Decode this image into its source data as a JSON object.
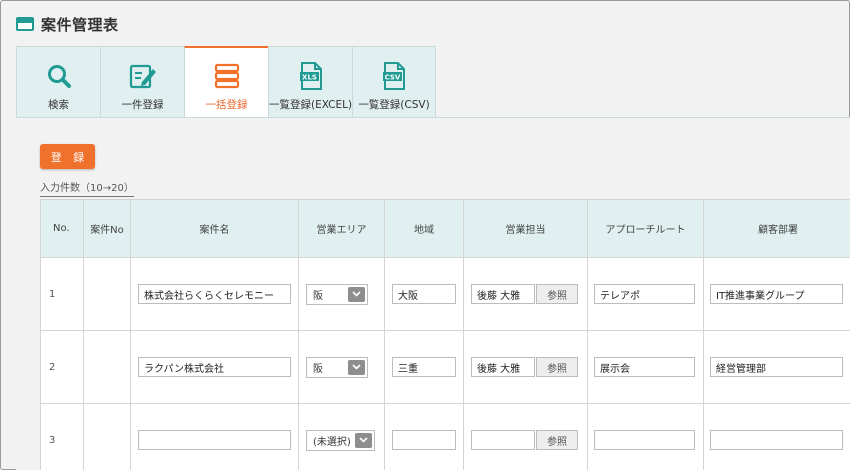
{
  "page": {
    "title": "案件管理表"
  },
  "tabs": [
    {
      "label": "検索",
      "icon": "search-icon"
    },
    {
      "label": "一件登録",
      "icon": "edit-icon"
    },
    {
      "label": "一括登録",
      "icon": "stack-icon",
      "active": true
    },
    {
      "label": "一覧登録(EXCEL)",
      "icon": "xls-file-icon",
      "badge": "XLS"
    },
    {
      "label": "一覧登録(CSV)",
      "icon": "csv-file-icon",
      "badge": "CSV"
    }
  ],
  "register_button": "登 録",
  "count_note": "入力件数（10→20）",
  "table": {
    "headers": [
      "No.",
      "案件No",
      "案件名",
      "営業エリア",
      "地域",
      "営業担当",
      "アプローチルート",
      "顧客部署"
    ],
    "rows": [
      {
        "no": "1",
        "case_no": "",
        "case_name": "株式会社らくらくセレモニー",
        "area": "阪",
        "region": "大阪",
        "sales_rep": "後藤 大雅",
        "ref": "参照",
        "route": "テレアポ",
        "dept": "IT推進事業グループ"
      },
      {
        "no": "2",
        "case_no": "",
        "case_name": "ラクパン株式会社",
        "area": "阪",
        "region": "三重",
        "sales_rep": "後藤 大雅",
        "ref": "参照",
        "route": "展示会",
        "dept": "経営管理部"
      },
      {
        "no": "3",
        "case_no": "",
        "case_name": "",
        "area": "(未選択)",
        "region": "",
        "sales_rep": "",
        "ref": "参照",
        "route": "",
        "dept": ""
      }
    ]
  },
  "colors": {
    "accent": "#f0712c",
    "teal": "#1f9b94",
    "tab_bg": "#e0efef"
  }
}
